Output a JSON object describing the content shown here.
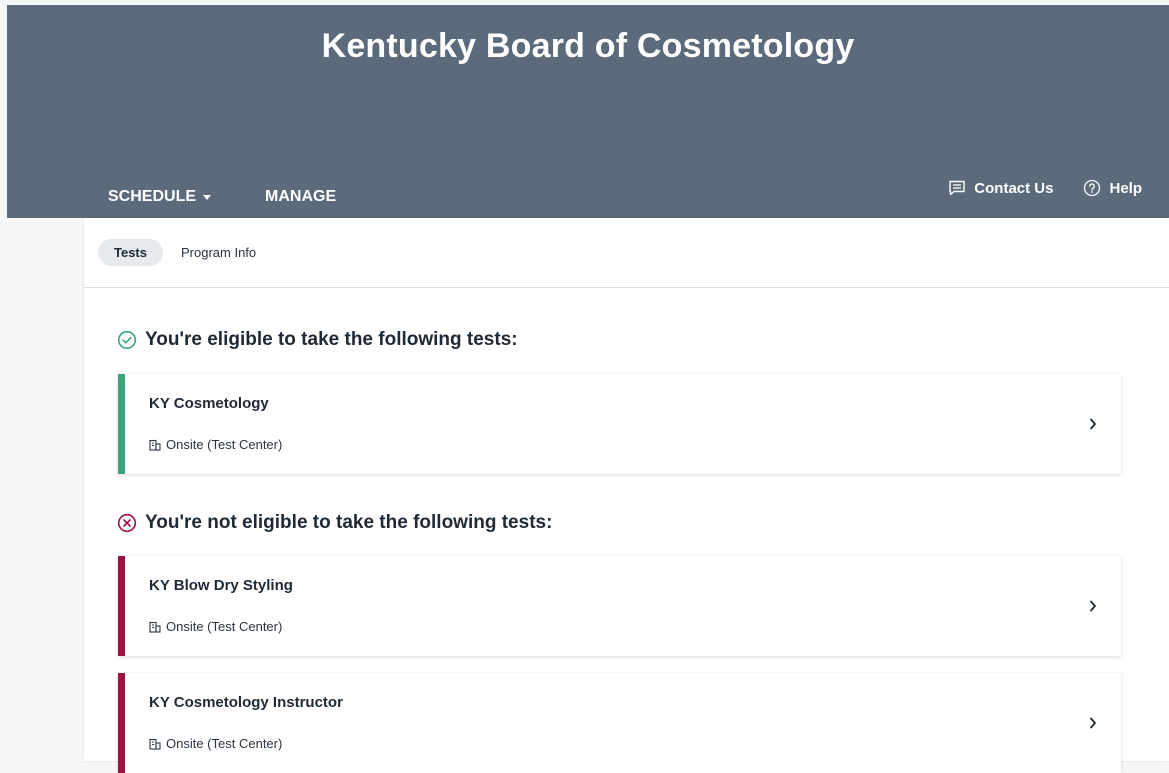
{
  "header": {
    "title": "Kentucky Board of Cosmetology",
    "background": "#5b6b7b"
  },
  "nav": {
    "items": [
      {
        "label": "SCHEDULE",
        "icon": "caret-down-icon"
      },
      {
        "label": "MANAGE"
      }
    ]
  },
  "utility": {
    "contact_label": "Contact Us",
    "contact_icon": "chat-icon",
    "help_label": "Help",
    "help_icon": "question-circle-icon"
  },
  "tabs": [
    {
      "label": "Tests",
      "active": true
    },
    {
      "label": "Program Info",
      "active": false
    }
  ],
  "eligible": {
    "heading": "You're eligible to take the following tests:",
    "icon": "check-circle-icon",
    "color": "#3aa57a",
    "tests": [
      {
        "name": "KY Cosmetology",
        "mode": "Onsite (Test Center)",
        "mode_icon": "building-icon"
      }
    ]
  },
  "not_eligible": {
    "heading": "You're not eligible to take the following tests:",
    "icon": "x-circle-icon",
    "color": "#9c1240",
    "tests": [
      {
        "name": "KY Blow Dry Styling",
        "mode": "Onsite (Test Center)",
        "mode_icon": "building-icon"
      },
      {
        "name": "KY Cosmetology Instructor",
        "mode": "Onsite (Test Center)",
        "mode_icon": "building-icon"
      }
    ]
  }
}
